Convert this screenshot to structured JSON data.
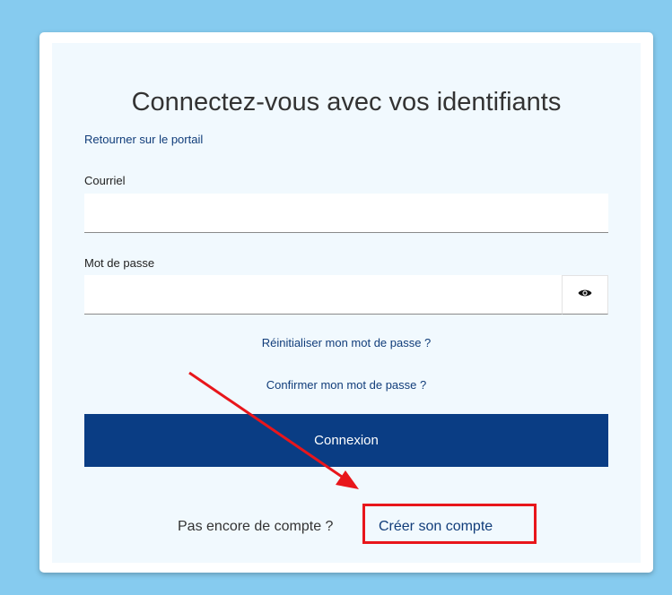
{
  "title": "Connectez-vous avec vos identifiants",
  "portal_link": "Retourner sur le portail",
  "email": {
    "label": "Courriel",
    "value": "",
    "placeholder": ""
  },
  "password": {
    "label": "Mot de passe",
    "value": "",
    "placeholder": "",
    "toggle_icon": "eye-icon"
  },
  "reset_link": "Réinitialiser mon mot de passe ?",
  "confirm_link": "Confirmer mon mot de passe ?",
  "connect_button": "Connexion",
  "signup": {
    "prompt": "Pas encore de compte ?",
    "link": "Créer son compte"
  },
  "colors": {
    "page_background": "#86cbef",
    "primary_button": "#0a3d84",
    "link": "#113d7a",
    "annotation": "#e8161b"
  }
}
